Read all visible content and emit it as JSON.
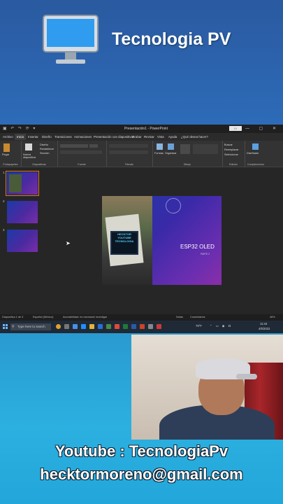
{
  "brand": {
    "title": "Tecnologia PV"
  },
  "powerpoint": {
    "window_title": "Presentación1 - PowerPoint",
    "account_badge": "I I    ",
    "tabs": [
      {
        "label": "Archivo"
      },
      {
        "label": "Inicio"
      },
      {
        "label": "Insertar"
      },
      {
        "label": "Diseño"
      },
      {
        "label": "Transiciones"
      },
      {
        "label": "Animaciones"
      },
      {
        "label": "Presentación con diapositivas"
      },
      {
        "label": "Grabar"
      },
      {
        "label": "Revisar"
      },
      {
        "label": "Vista"
      },
      {
        "label": "Ayuda"
      },
      {
        "label": "¿Qué desea hacer?"
      }
    ],
    "ribbon": {
      "clipboard": {
        "paste": "Pegar",
        "label": "Portapapeles"
      },
      "slides": {
        "new_slide": "Nueva diapositiva",
        "layout": "Diseño",
        "reset": "Restablecer",
        "section": "Sección",
        "label": "Diapositivas"
      },
      "font": {
        "label": "Fuente"
      },
      "paragraph": {
        "label": "Párrafo"
      },
      "drawing": {
        "shapes": "Formas",
        "arrange": "Organizar",
        "label": "Dibujo"
      },
      "editing": {
        "find": "Buscar",
        "replace": "Reemplazar",
        "select": "Seleccionar",
        "label": "Edición"
      },
      "addins": {
        "designer": "Diseñador",
        "label": "Complementos"
      }
    },
    "thumbnails": [
      {
        "num": "1",
        "selected": true
      },
      {
        "num": "2",
        "selected": false
      },
      {
        "num": "3",
        "selected": false
      }
    ],
    "slide": {
      "title": "ESP32 OLED",
      "subtitle": "PARTE 2",
      "oled_lines": [
        "HECKTOR",
        "YOUTUBE",
        "TECNOLOGIA"
      ]
    },
    "statusbar": {
      "slide_count": "Diapositiva 1 de 3",
      "language": "Español (México)",
      "accessibility": "Accesibilidad: es necesario investigar",
      "notes": "Notas",
      "comments": "Comentarios",
      "zoom": "46%"
    },
    "taskbar": {
      "search_placeholder": "Type here to search",
      "weather": "79°F",
      "time": "11:44",
      "date": "4/5/2022"
    }
  },
  "contact": {
    "youtube": "Youtube : TecnologiaPv",
    "email": "hecktormoreno@gmail.com"
  },
  "colors": {
    "banner_blue": "#2a5aa0",
    "bottom_blue": "#2bb0e0",
    "selection_orange": "#e07a2a"
  }
}
